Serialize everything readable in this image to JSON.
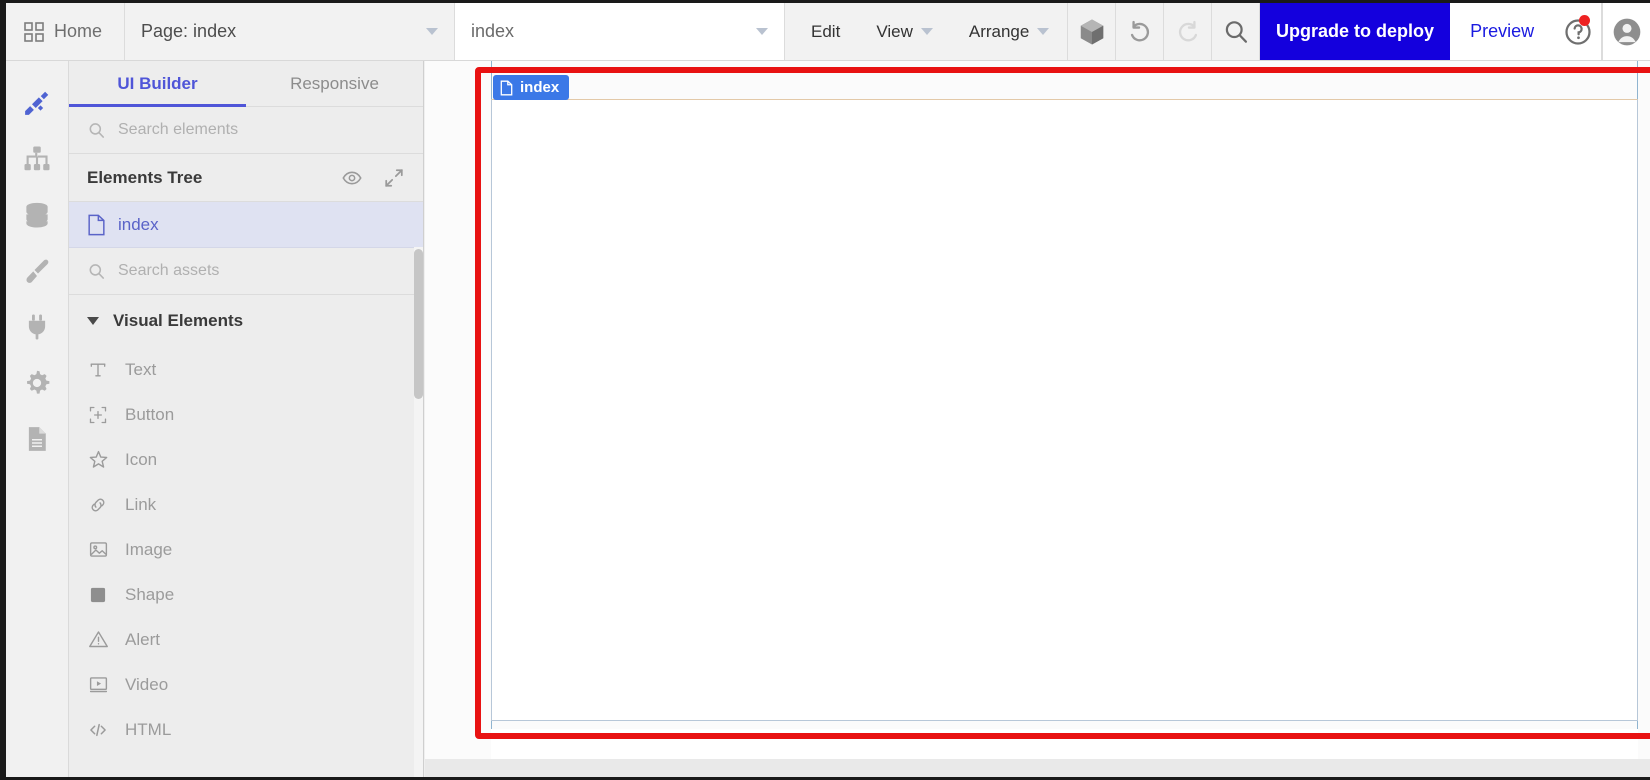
{
  "topbar": {
    "home_label": "Home",
    "page_label": "Page: index",
    "page_name_value": "index",
    "menus": [
      {
        "label": "Edit",
        "has_caret": false
      },
      {
        "label": "View",
        "has_caret": true
      },
      {
        "label": "Arrange",
        "has_caret": true
      }
    ],
    "cube_icon": "3d-cube-icon",
    "undo_icon": "undo-icon",
    "redo_icon": "redo-icon",
    "search_icon": "search-icon",
    "upgrade_label": "Upgrade to deploy",
    "preview_label": "Preview",
    "help_icon": "help-question-icon",
    "avatar_icon": "user-avatar-icon",
    "accent_blue": "#1400dd",
    "preview_blue": "#1a1ae0",
    "notification_dot": "#ee2222"
  },
  "rail": {
    "items": [
      {
        "name": "design-tools-icon",
        "active": true
      },
      {
        "name": "sitemap-icon",
        "active": false
      },
      {
        "name": "database-icon",
        "active": false
      },
      {
        "name": "paintbrush-icon",
        "active": false
      },
      {
        "name": "plugin-icon",
        "active": false
      },
      {
        "name": "settings-gear-icon",
        "active": false
      },
      {
        "name": "document-icon",
        "active": false
      }
    ]
  },
  "panel": {
    "tabs": [
      {
        "label": "UI Builder",
        "active": true
      },
      {
        "label": "Responsive",
        "active": false
      }
    ],
    "search_elements_placeholder": "Search elements",
    "elements_tree_title": "Elements Tree",
    "eye_icon": "eye-icon",
    "expand_icon": "expand-diagonal-icon",
    "tree_items": [
      {
        "label": "index",
        "icon": "page-file-icon",
        "selected": true
      }
    ],
    "search_assets_placeholder": "Search assets",
    "section_title": "Visual Elements",
    "elements": [
      {
        "label": "Text",
        "icon": "text-t-icon"
      },
      {
        "label": "Button",
        "icon": "button-plus-icon"
      },
      {
        "label": "Icon",
        "icon": "star-icon"
      },
      {
        "label": "Link",
        "icon": "link-chain-icon"
      },
      {
        "label": "Image",
        "icon": "image-picture-icon"
      },
      {
        "label": "Shape",
        "icon": "shape-square-icon"
      },
      {
        "label": "Alert",
        "icon": "alert-triangle-icon"
      },
      {
        "label": "Video",
        "icon": "video-play-icon"
      },
      {
        "label": "HTML",
        "icon": "code-html-icon"
      }
    ]
  },
  "canvas": {
    "page_badge_label": "index",
    "page_badge_icon": "page-file-icon",
    "highlight_color": "#e81212",
    "badge_color": "#3b78e7"
  }
}
